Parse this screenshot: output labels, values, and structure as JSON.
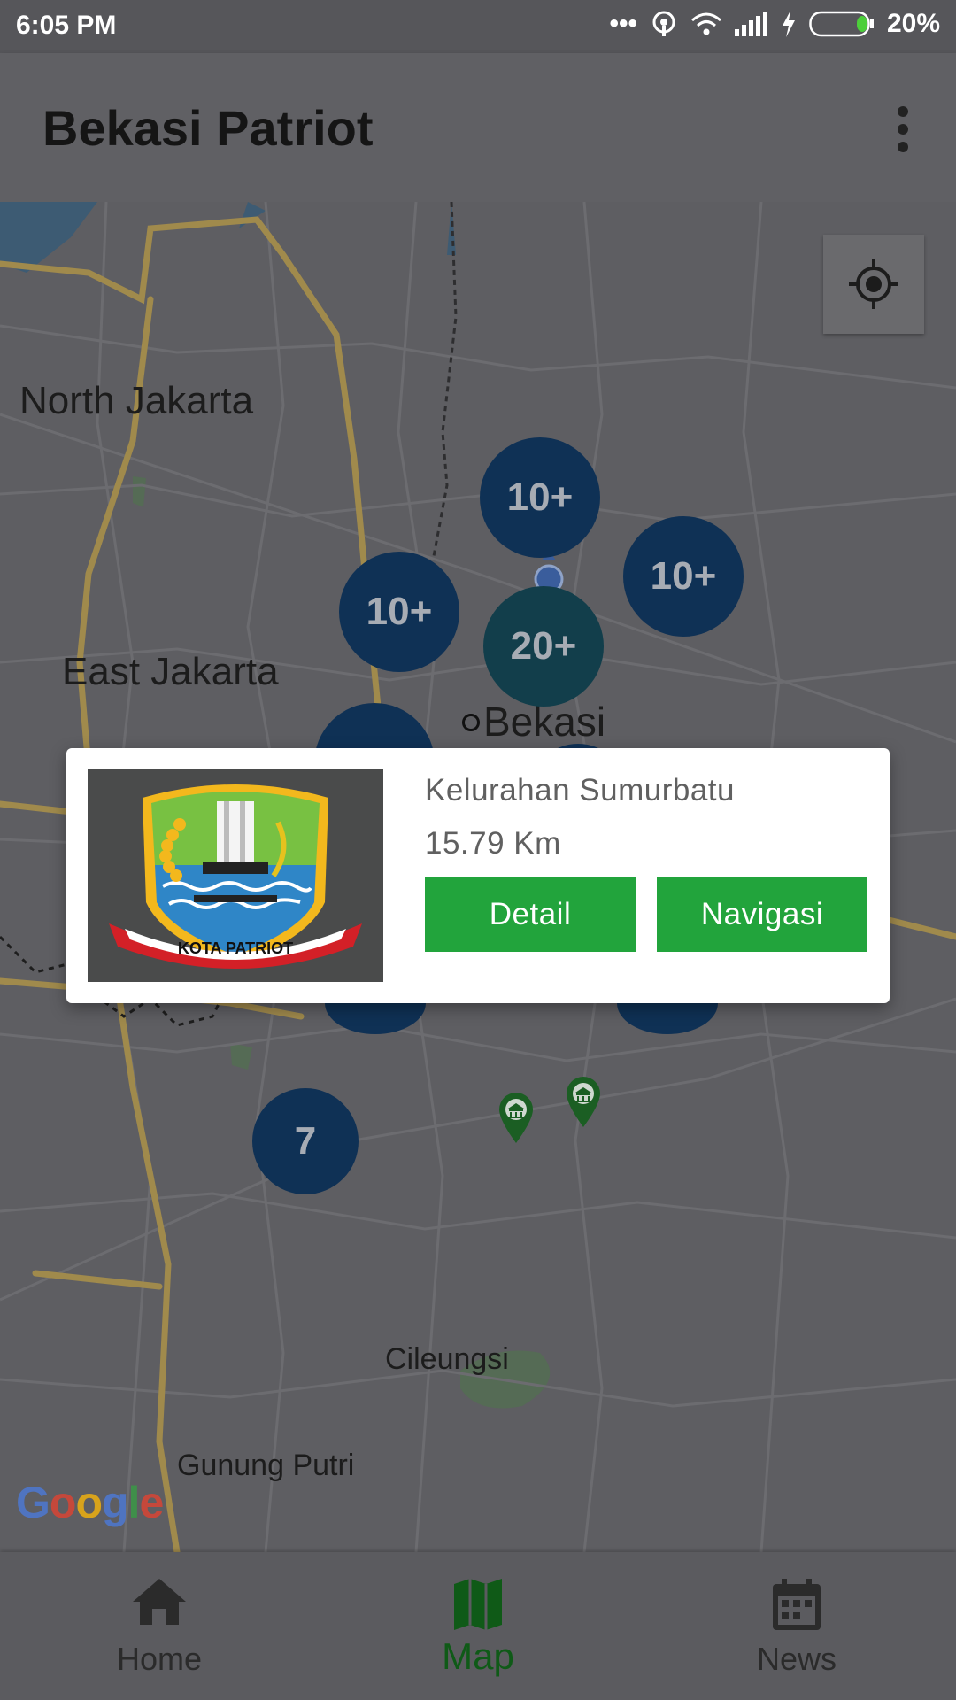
{
  "status_bar": {
    "time": "6:05 PM",
    "battery": "20%"
  },
  "app_bar": {
    "title": "Bekasi Patriot",
    "overflow_icon": "more-vert-icon"
  },
  "map": {
    "labels": {
      "north_jakarta": "North Jakarta",
      "east_jakarta": "East Jakarta",
      "bekasi": "Bekasi",
      "cileungsi": "Cileungsi",
      "gunung_putri": "Gunung Putri"
    },
    "clusters": [
      "10+",
      "10+",
      "10+",
      "20+",
      "7"
    ],
    "attribution": "Google",
    "my_location_icon": "my-location-icon",
    "marker_icon": "government-building-pin-icon"
  },
  "popup": {
    "name": "Kelurahan Sumurbatu",
    "distance": "15.79 Km",
    "detail_label": "Detail",
    "navigate_label": "Navigasi",
    "logo_text": "KOTA PATRIOT",
    "accent_color": "#22a43c"
  },
  "bottom_nav": [
    {
      "label": "Home",
      "icon": "home-icon"
    },
    {
      "label": "Map",
      "icon": "map-icon"
    },
    {
      "label": "News",
      "icon": "calendar-icon"
    }
  ]
}
